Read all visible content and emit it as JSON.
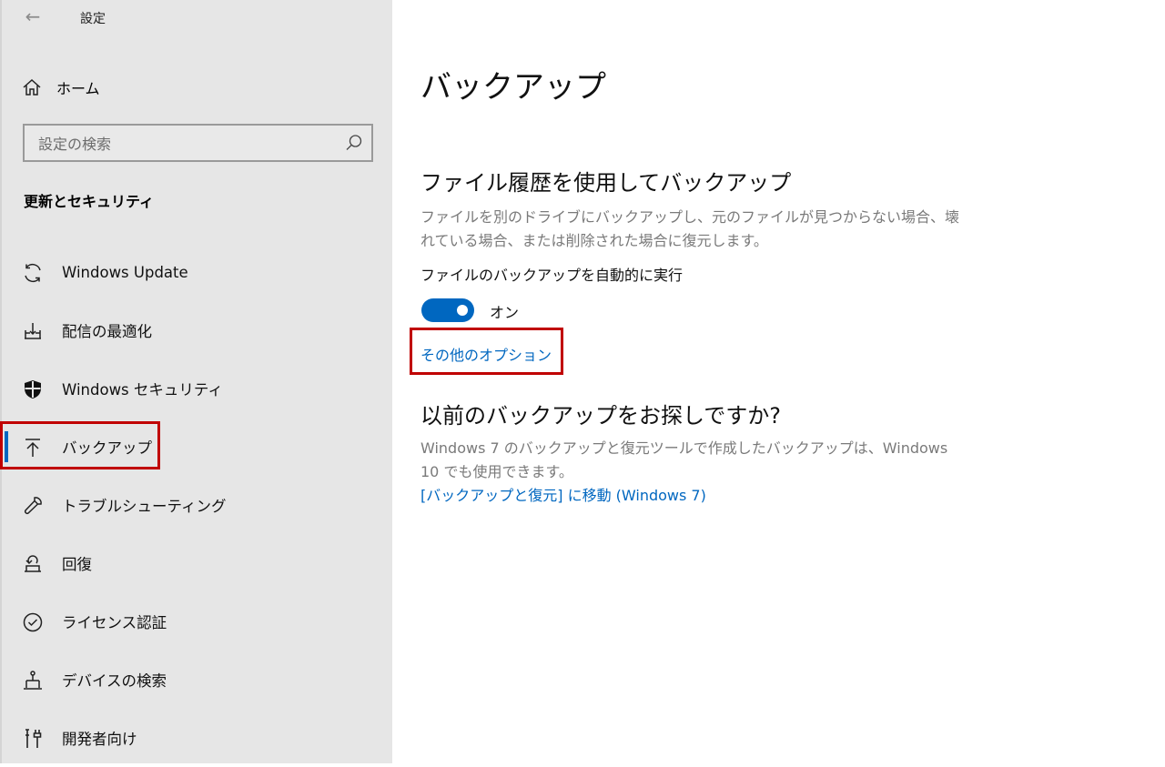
{
  "window": {
    "title": "設定"
  },
  "sidebar": {
    "home_label": "ホーム",
    "search_placeholder": "設定の検索",
    "section_title": "更新とセキュリティ",
    "items": [
      {
        "label": "Windows Update",
        "icon": "sync-icon"
      },
      {
        "label": "配信の最適化",
        "icon": "delivery-optimization-icon"
      },
      {
        "label": "Windows セキュリティ",
        "icon": "shield-icon"
      },
      {
        "label": "バックアップ",
        "icon": "backup-arrow-up-icon",
        "selected": true
      },
      {
        "label": "トラブルシューティング",
        "icon": "wrench-icon"
      },
      {
        "label": "回復",
        "icon": "recovery-icon"
      },
      {
        "label": "ライセンス認証",
        "icon": "check-circle-icon"
      },
      {
        "label": "デバイスの検索",
        "icon": "find-device-icon"
      },
      {
        "label": "開発者向け",
        "icon": "developer-tools-icon"
      }
    ]
  },
  "main": {
    "title": "バックアップ",
    "file_history": {
      "heading": "ファイル履歴を使用してバックアップ",
      "description": "ファイルを別のドライブにバックアップし、元のファイルが見つからない場合、壊れている場合、または削除された場合に復元します。",
      "auto_backup_label": "ファイルのバックアップを自動的に実行",
      "toggle_state": "オン",
      "toggle_on": true,
      "more_options_link": "その他のオプション"
    },
    "older_backup": {
      "heading": "以前のバックアップをお探しですか?",
      "description": "Windows 7 のバックアップと復元ツールで作成したバックアップは、Windows 10 でも使用できます。",
      "link": "[バックアップと復元] に移動 (Windows 7)"
    }
  },
  "colors": {
    "accent": "#0067c0",
    "highlight": "#c00000",
    "sidebar_bg": "#e6e6e6"
  }
}
